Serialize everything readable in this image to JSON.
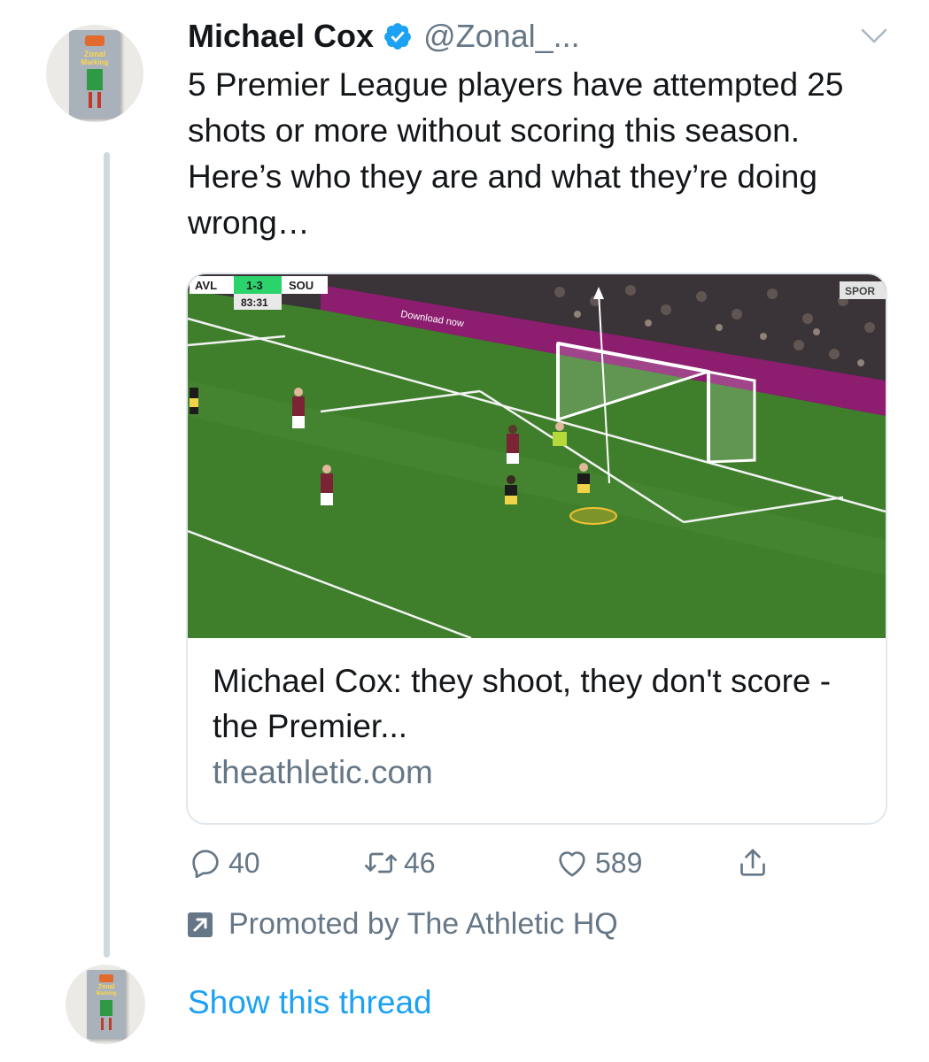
{
  "tweet": {
    "author_name": "Michael Cox",
    "author_handle": "@Zonal_...",
    "verified": true,
    "text": "5 Premier League players have attempted 25 shots or more without scoring this season. Here’s who they are and what they’re doing wrong…",
    "avatar_text": [
      "Zonal",
      "Marking"
    ]
  },
  "card": {
    "title": "Michael Cox: they shoot, they don't score - the Premier...",
    "domain": "theathletic.com",
    "scoreboard": {
      "home": "AVL",
      "score": "1-3",
      "away": "SOU",
      "time": "83:31"
    },
    "board_text": "Download now",
    "broadcaster": "SPOR"
  },
  "actions": {
    "replies": "40",
    "retweets": "46",
    "likes": "589"
  },
  "promoted_text": "Promoted by The Athletic HQ",
  "show_thread": "Show this thread",
  "colors": {
    "link_blue": "#1da1f2",
    "secondary_text": "#657786",
    "pitch_green": "#3f7f2c",
    "board_magenta": "#8c1d6f"
  },
  "icons": [
    "verified-badge-icon",
    "chevron-down-icon",
    "reply-icon",
    "retweet-icon",
    "like-icon",
    "share-icon",
    "promoted-icon"
  ]
}
